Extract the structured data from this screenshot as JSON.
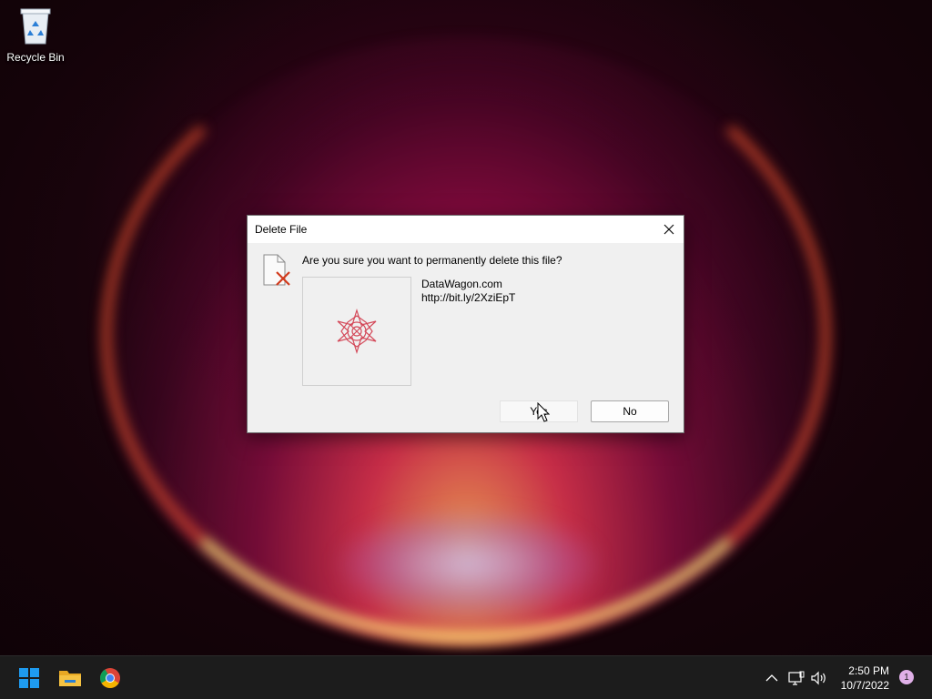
{
  "desktop": {
    "icons": [
      {
        "label": "Recycle Bin",
        "icon": "recycle-bin-icon"
      }
    ]
  },
  "dialog": {
    "title": "Delete File",
    "question": "Are you sure you want to permanently delete this file?",
    "file_name": "DataWagon.com",
    "file_detail": "http://bit.ly/2XziEpT",
    "yes_label": "Yes",
    "no_label": "No",
    "icons": {
      "dialog": "delete-file-icon",
      "thumbnail": "file-thumbnail-icon",
      "close": "close-icon"
    }
  },
  "taskbar": {
    "apps": [
      {
        "name": "Start",
        "icon": "windows-start-icon"
      },
      {
        "name": "File Explorer",
        "icon": "folder-icon"
      },
      {
        "name": "Google Chrome",
        "icon": "chrome-icon"
      }
    ],
    "tray": {
      "icons": [
        "chevron-up-icon",
        "network-icon",
        "volume-icon"
      ],
      "time": "2:50 PM",
      "date": "10/7/2022",
      "notification_count": "1"
    }
  },
  "colors": {
    "accent_start": "#1e9bf0",
    "folder": "#f5c242",
    "dialog_bg": "#f0f0f0",
    "delete_x": "#d13a1c",
    "thumbnail_star": "#d44a5a"
  }
}
